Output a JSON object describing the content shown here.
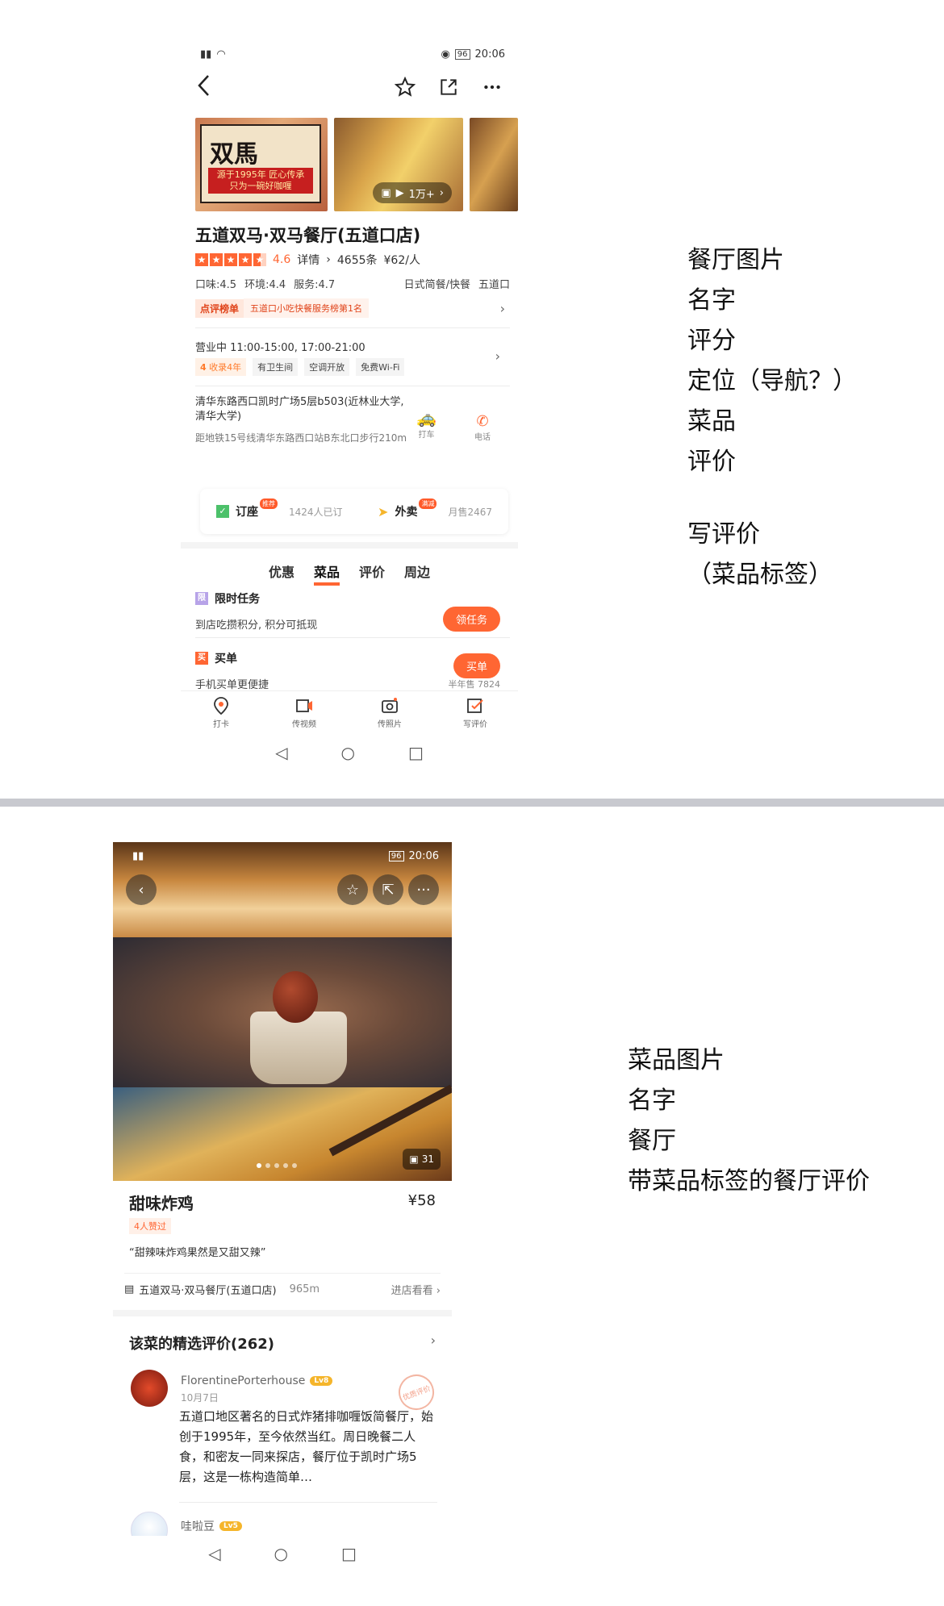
{
  "colors": {
    "accent": "#ff6633",
    "divider": "#c8c9cf"
  },
  "screen1": {
    "status": {
      "time": "20:06",
      "battery": "96"
    },
    "nav": {
      "back_icon": "chevron-left-icon",
      "star_icon": "star-icon",
      "share_icon": "share-icon",
      "more_icon": "more-icon"
    },
    "gallery": {
      "sign_brand": "双馬",
      "sign_slogan_1": "源于1995年 匠心传承",
      "sign_slogan_2": "只为一碗好咖喱",
      "photo_count": "1万+"
    },
    "restaurant_name": "五道双马·双马餐厅(五道口店)",
    "rating": {
      "score": "4.6",
      "details": "详情",
      "reviews": "4655条",
      "price": "¥62/人"
    },
    "sub_scores": {
      "taste": "口味:4.5",
      "env": "环境:4.4",
      "service": "服务:4.7",
      "category": "日式简餐/快餐",
      "area": "五道口"
    },
    "rank": {
      "badge": "点评榜单",
      "text": "五道口小吃快餐服务榜第1名"
    },
    "hours": "营业中 11:00-15:00, 17:00-21:00",
    "tags": [
      "收录4年",
      "有卫生间",
      "空调开放",
      "免费Wi-Fi"
    ],
    "tag_num": "4",
    "address": "清华东路西口凯时广场5层b503(近林业大学, 清华大学)",
    "metro": "距地铁15号线清华东路西口站B东北口步行210m",
    "taxi": "打车",
    "taxi_badge": "打车",
    "phone": "电话",
    "order": {
      "seat": "订座",
      "seat_badge": "推荐",
      "seat_count": "1424人已订",
      "takeout": "外卖",
      "takeout_badge": "满减",
      "takeout_count": "月售2467"
    },
    "tabs": [
      "优惠",
      "菜品",
      "评价",
      "周边"
    ],
    "task": {
      "badge": "限",
      "title": "限时任务",
      "desc": "到店吃攒积分, 积分可抵现",
      "button": "领任务"
    },
    "pay": {
      "badge": "买",
      "title": "买单",
      "desc": "手机买单更便捷",
      "button": "买单",
      "sales": "半年售 7824"
    },
    "bottom": [
      "打卡",
      "传视频",
      "传照片",
      "写评价"
    ]
  },
  "annotations_top": [
    "餐厅图片",
    "名字",
    "评分",
    "定位（导航？）",
    "菜品",
    "评价",
    "",
    "写评价",
    "（菜品标签）"
  ],
  "screen2": {
    "status": {
      "time": "20:06",
      "battery": "96"
    },
    "image_count": "31",
    "dish_name": "甜味炸鸡",
    "price": "¥58",
    "likes": "4人赞过",
    "quote": "“甜辣味炸鸡果然是又甜又辣”",
    "shop": {
      "name": "五道双马·双马餐厅(五道口店)",
      "distance": "965m",
      "enter": "进店看看"
    },
    "reviews_title": "该菜的精选评价(262)",
    "review1": {
      "user": "FlorentinePorterhouse",
      "level": "Lv8",
      "date": "10月7日",
      "stamp": "优质评价",
      "body": "五道口地区著名的日式炸猪排咖喱饭简餐厅，始创于1995年，至今依然当红。周日晚餐二人食，和密友一同来探店，餐厅位于凯时广场5层，这是一栋构造简单…"
    },
    "review2": {
      "user": "哇啦豆",
      "level": "Lv5"
    }
  },
  "annotations_bottom": [
    "菜品图片",
    "名字",
    "餐厅",
    "带菜品标签的餐厅评价"
  ]
}
